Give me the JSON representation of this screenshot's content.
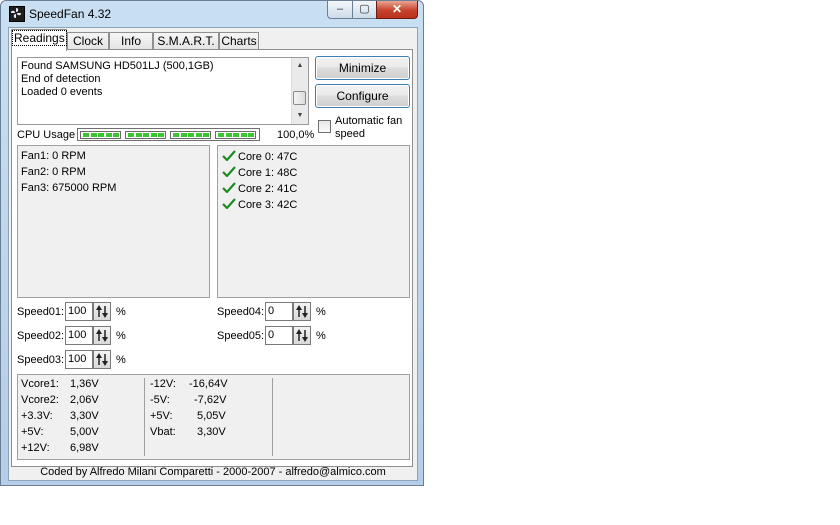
{
  "window": {
    "title": "SpeedFan 4.32",
    "controls": {
      "minimize": "–",
      "maximize": "▢",
      "close": "✕"
    }
  },
  "tabs": [
    "Readings",
    "Clock",
    "Info",
    "S.M.A.R.T.",
    "Charts"
  ],
  "active_tab": "Readings",
  "log": [
    "Found SAMSUNG HD501LJ (500,1GB)",
    "End of detection",
    "Loaded 0 events"
  ],
  "buttons": {
    "minimize": "Minimize",
    "configure": "Configure"
  },
  "auto_fan": {
    "label_line1": "Automatic fan",
    "label_line2": "speed",
    "checked": false
  },
  "cpu_usage": {
    "label": "CPU Usage",
    "value": "100,0%",
    "level": 1.0
  },
  "fans": [
    "Fan1: 0 RPM",
    "Fan2: 0 RPM",
    "Fan3: 675000 RPM"
  ],
  "temps": [
    "Core 0: 47C",
    "Core 1: 48C",
    "Core 2: 41C",
    "Core 3: 42C"
  ],
  "speeds": {
    "s01": {
      "label": "Speed01:",
      "value": "100",
      "unit": "%"
    },
    "s02": {
      "label": "Speed02:",
      "value": "100",
      "unit": "%"
    },
    "s03": {
      "label": "Speed03:",
      "value": "100",
      "unit": "%"
    },
    "s04": {
      "label": "Speed04:",
      "value": "0",
      "unit": "%"
    },
    "s05": {
      "label": "Speed05:",
      "value": "0",
      "unit": "%"
    }
  },
  "voltages": {
    "col1": [
      {
        "label": "Vcore1:",
        "value": "1,36V"
      },
      {
        "label": "Vcore2:",
        "value": "2,06V"
      },
      {
        "label": "+3.3V:",
        "value": "3,30V"
      },
      {
        "label": "+5V:",
        "value": "5,00V"
      },
      {
        "label": "+12V:",
        "value": "6,98V"
      }
    ],
    "col2": [
      {
        "label": "-12V:",
        "value": "-16,64V"
      },
      {
        "label": "-5V:",
        "value": "-7,62V"
      },
      {
        "label": "+5V:",
        "value": "5,05V"
      },
      {
        "label": "Vbat:",
        "value": "3,30V"
      }
    ]
  },
  "footer": "Coded by Alfredo Milani Comparetti - 2000-2007 - alfredo@almico.com",
  "colors": {
    "cpu_bar": "#39c630",
    "check": "#1e8a1e",
    "close_button": "#c7432d"
  }
}
